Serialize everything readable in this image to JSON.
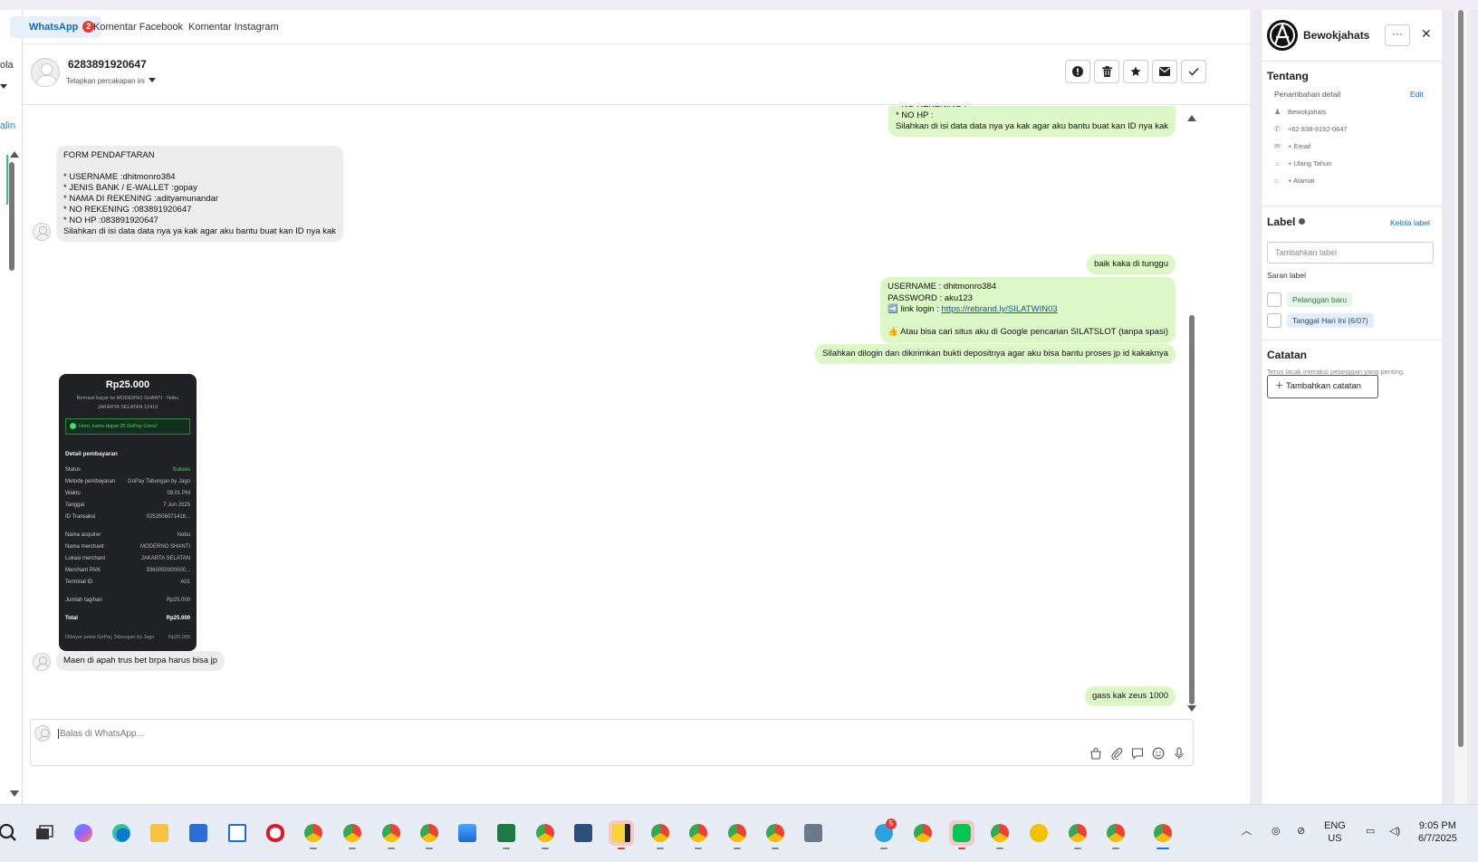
{
  "tabs": [
    {
      "label": "WhatsApp",
      "badge": "2"
    },
    {
      "label": "Komentar Facebook"
    },
    {
      "label": "Komentar Instagram"
    }
  ],
  "left_sidebar": {
    "frag1": "ola",
    "frag2": "alin"
  },
  "chat": {
    "phone": "6283891920647",
    "pin_label": "Tetapkan percakapan ini",
    "actions": [
      "alert-icon",
      "trash-icon",
      "star-icon",
      "mail-icon",
      "check-icon"
    ]
  },
  "messages": {
    "out_top": "* NO REKENING :\n* NO HP :\nSilahkan di isi data data nya ya kak agar aku bantu buat kan ID nya kak",
    "in_form": "FORM PENDAFTARAN\n\n* USERNAME :dhitmonro384\n* JENIS BANK / E-WALLET :gopay\n* NAMA DI REKENING :adityamunandar\n* NO REKENING :083891920647\n* NO HP :083891920647\nSilahkan di isi data data nya ya kak agar aku bantu buat kan ID nya kak",
    "out_wait": "baik kaka di tunggu",
    "out_creds_1": "USERNAME : dhitmonro384\nPASSWORD : aku123",
    "out_creds_link_prefix": "➡️ link login : ",
    "out_creds_link": "https://rebrand.ly/SILATWIN03",
    "out_creds_2": "👍 Atau bisa cari situs aku di Google pencarian SILATSLOT (tanpa spasi)",
    "out_deposit": "Silahkan dilogin dan dikirimkan bukti depositnya agar aku bisa bantu proses jp id kakaknya",
    "in_question": "Maen di apah trus bet brpa harus bisa jp",
    "out_last": "gass kak zeus 1000"
  },
  "receipt": {
    "amount": "Rp25.000",
    "line1": "Berhasil bayar ke MODERNO SHANTI · Nobu",
    "line2": "JAKARTA SELATAN 12410",
    "promo": "Hore, kamu dapat 25 GoPay Coins!",
    "header": "Detail pembayaran",
    "rows": [
      [
        "Status",
        "Sukses"
      ],
      [
        "Metode pembayaran",
        "GoPay Tabungan by Jago"
      ],
      [
        "Waktu",
        "09:01 PM"
      ],
      [
        "Tanggal",
        "7 Jun 2025"
      ],
      [
        "ID Transaksi",
        "0252506071418..."
      ]
    ],
    "rows2": [
      [
        "Nama acquirer",
        "Nobu"
      ],
      [
        "Nama merchant",
        "MODERNO SHANTI"
      ],
      [
        "Lokasi merchant",
        "JAKARTA SELATAN"
      ],
      [
        "Merchant PAN",
        "9360050300000..."
      ],
      [
        "Terminal ID",
        "A01"
      ]
    ],
    "bill": [
      "Jumlah tagihan",
      "Rp25.000"
    ],
    "total": [
      "Total",
      "Rp25.000"
    ],
    "foot": [
      "Dibayar pakai GoPay Tabungan by Jago",
      "Rp25.000"
    ]
  },
  "composer": {
    "placeholder": "Balas di WhatsApp..."
  },
  "contact": {
    "name": "Bewokjahats",
    "more": "···",
    "tentang": "Tentang",
    "penambahan": "Penambahan detail",
    "edit": "Edit",
    "details": [
      {
        "icon": "person-icon",
        "glyph": "♟",
        "text": "Bewokjahats"
      },
      {
        "icon": "phone-icon",
        "glyph": "✆",
        "text": "+62 838-9192-0647"
      },
      {
        "icon": "email-icon",
        "glyph": "✉",
        "text": "+ Email"
      },
      {
        "icon": "cake-icon",
        "glyph": "♨",
        "text": "+ Ulang Tahun"
      },
      {
        "icon": "home-icon",
        "glyph": "⌂",
        "text": "+ Alamat"
      }
    ],
    "label_title": "Label",
    "kelola_label": "Kelola label",
    "label_input": "Tambahkan label",
    "saran_label": "Saran label",
    "chips": [
      "Pelanggan baru",
      "Tanggal Hari Ini (6/07)"
    ],
    "catatan": "Catatan",
    "catatan_hint": "Terus lacak interaksi pelanggan yang penting.",
    "add_note": "Tambahkan catatan"
  },
  "taskbar": {
    "lang1": "ENG",
    "lang2": "US",
    "time": "9:05 PM",
    "date": "6/7/2025",
    "telegram_badge": "5"
  },
  "colors": {
    "accent": "#1565c0",
    "outgoing": "#dcf8c6",
    "incoming": "#ededed",
    "badge": "#e53935"
  }
}
